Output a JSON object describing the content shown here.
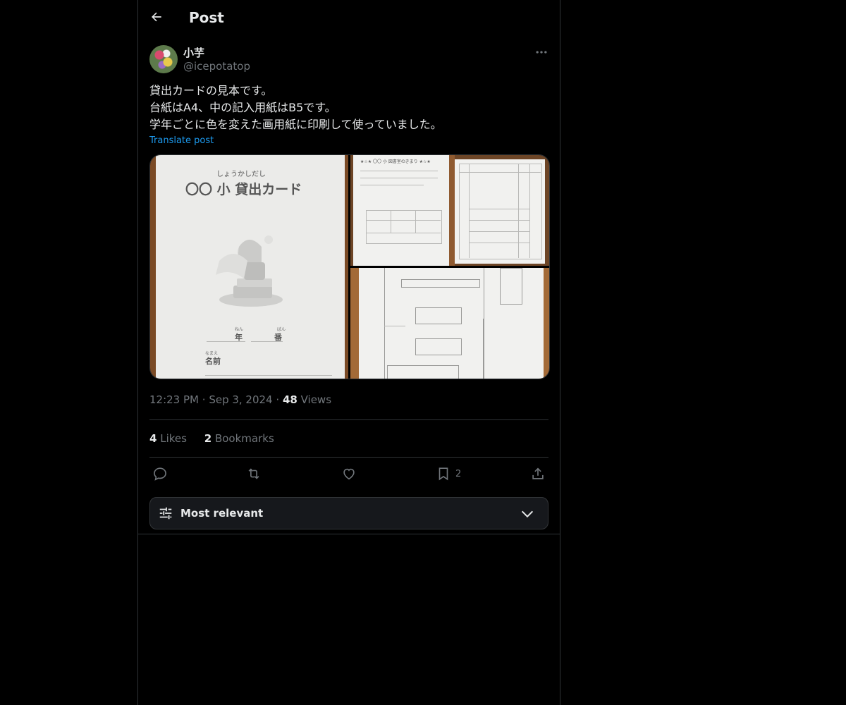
{
  "header": {
    "title": "Post"
  },
  "author": {
    "display_name": "小芋",
    "handle": "@icepotatop"
  },
  "post": {
    "lines": [
      "貸出カードの見本です。",
      "台紙はA4、中の記入用紙はB5です。",
      "学年ごとに色を変えた画用紙に印刷して使っていました。"
    ],
    "translate_label": "Translate post"
  },
  "media": {
    "card_ruby": "しょうかしだし",
    "card_title": "〇〇 小 貸出カード",
    "card_year": "年",
    "card_number": "番",
    "card_name": "名前"
  },
  "meta": {
    "time": "12:23 PM",
    "date": "Sep 3, 2024",
    "views_count": "48",
    "views_label": "Views"
  },
  "stats": {
    "likes_count": "4",
    "likes_label": "Likes",
    "bookmarks_count": "2",
    "bookmarks_label": "Bookmarks"
  },
  "actions": {
    "bookmark_count": "2"
  },
  "sort": {
    "label": "Most relevant"
  },
  "icons": [
    "back-arrow-icon",
    "more-icon",
    "reply-icon",
    "repost-icon",
    "like-icon",
    "bookmark-icon",
    "share-icon",
    "sliders-icon",
    "chevron-down-icon"
  ]
}
